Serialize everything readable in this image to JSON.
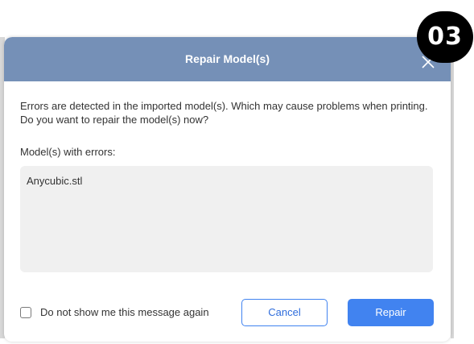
{
  "dialog": {
    "title": "Repair Model(s)",
    "close_icon": "close-icon",
    "message": "Errors are detected in the imported model(s). Which may cause problems when printing. Do you want to repair the model(s) now?",
    "errors_label": "Model(s) with errors:",
    "error_models": [
      "Anycubic.stl"
    ],
    "dont_show_label": "Do not show me this message again",
    "dont_show_checked": false,
    "cancel_label": "Cancel",
    "repair_label": "Repair"
  },
  "badge": {
    "text": "03"
  },
  "colors": {
    "titlebar": "#7590b7",
    "primary": "#4183f0",
    "errors_box": "#f0f0f0",
    "badge": "#000000"
  }
}
